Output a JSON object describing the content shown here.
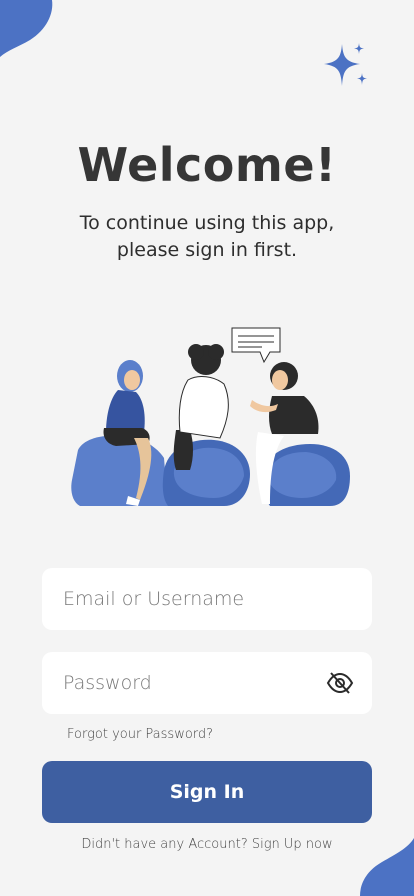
{
  "header": {
    "title": "Welcome!",
    "subtitle_line1": "To continue using this app,",
    "subtitle_line2": "please sign in first."
  },
  "form": {
    "email_placeholder": "Email or Username",
    "email_value": "",
    "password_placeholder": "Password",
    "password_value": "",
    "forgot_label": "Forgot your Password?",
    "signin_label": "Sign In"
  },
  "footer": {
    "signup_prompt": "Didn't have any Account?",
    "signup_link": "Sign Up now"
  },
  "icons": {
    "password_toggle": "eye-off-icon",
    "decoration": "sparkles-icon"
  },
  "colors": {
    "accent": "#3e5fa1",
    "accent_light": "#5b7fcb",
    "background": "#f4f4f4",
    "text": "#363636"
  }
}
